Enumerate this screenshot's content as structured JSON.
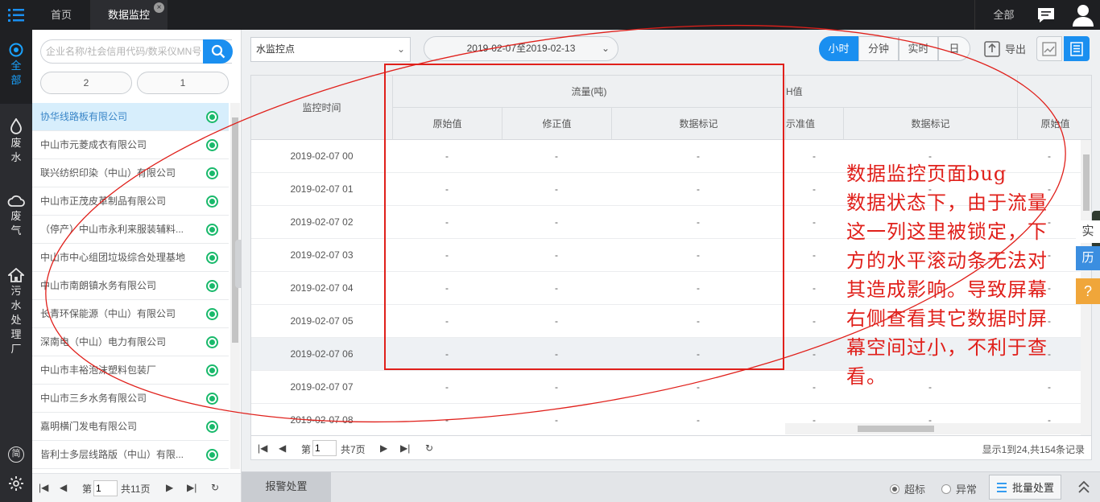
{
  "topbar": {
    "tabs": [
      {
        "label": "首页"
      },
      {
        "label": "数据监控",
        "close": "×"
      }
    ],
    "all_label": "全部"
  },
  "leftnav": {
    "items": [
      {
        "label": "全部"
      },
      {
        "label": "废水"
      },
      {
        "label": "废气"
      },
      {
        "label": "污水处理厂"
      }
    ],
    "simple_label": "简"
  },
  "panel": {
    "search_placeholder": "企业名称/社会信用代码/数采仪MN号",
    "pills": [
      "2",
      "1"
    ],
    "companies": [
      {
        "name": "协华线路板有限公司",
        "selected": true
      },
      {
        "name": "中山市元菱成衣有限公司"
      },
      {
        "name": "联兴纺织印染（中山）有限公司"
      },
      {
        "name": "中山市正茂皮革制品有限公司"
      },
      {
        "name": "（停产）中山市永利来服装辅料..."
      },
      {
        "name": "中山市中心组团垃圾综合处理基地"
      },
      {
        "name": "中山市南朗镇水务有限公司"
      },
      {
        "name": "长青环保能源（中山）有限公司"
      },
      {
        "name": "深南电（中山）电力有限公司"
      },
      {
        "name": "中山市丰裕泡沫塑料包装厂"
      },
      {
        "name": "中山市三乡水务有限公司"
      },
      {
        "name": "嘉明横门发电有限公司"
      },
      {
        "name": "皆利士多层线路版（中山）有限..."
      }
    ],
    "pager": {
      "prefix": "第",
      "page": "1",
      "total": "共11页"
    }
  },
  "toolbar": {
    "point_select": "水监控点",
    "date_range": "2019-02-07至2019-02-13",
    "segments": [
      "小时",
      "分钟",
      "实时",
      "日"
    ],
    "export_label": "导出"
  },
  "table": {
    "headers": {
      "time": "监控时间",
      "flow": "流量(吨)",
      "ph": "H值",
      "raw": "原始值",
      "fixed": "修正值",
      "mark": "数据标记",
      "ph_standard": "示准值",
      "ph_mark": "数据标记",
      "raw2": "原始值"
    },
    "rows": [
      {
        "time": "2019-02-07 00",
        "raw": "-",
        "fixed": "-",
        "mark": "-",
        "ph": "-",
        "phmark": "-",
        "raw2": "-"
      },
      {
        "time": "2019-02-07 01",
        "raw": "-",
        "fixed": "-",
        "mark": "-",
        "ph": "-",
        "phmark": "-",
        "raw2": "-"
      },
      {
        "time": "2019-02-07 02",
        "raw": "-",
        "fixed": "-",
        "mark": "-",
        "ph": "-",
        "phmark": "-",
        "raw2": "-"
      },
      {
        "time": "2019-02-07 03",
        "raw": "-",
        "fixed": "-",
        "mark": "-",
        "ph": "-",
        "phmark": "-",
        "raw2": "-"
      },
      {
        "time": "2019-02-07 04",
        "raw": "-",
        "fixed": "-",
        "mark": "-",
        "ph": "-",
        "phmark": "-",
        "raw2": "-"
      },
      {
        "time": "2019-02-07 05",
        "raw": "-",
        "fixed": "-",
        "mark": "-",
        "ph": "-",
        "phmark": "-",
        "raw2": "-"
      },
      {
        "time": "2019-02-07 06",
        "raw": "-",
        "fixed": "-",
        "mark": "-",
        "ph": "-",
        "phmark": "-",
        "raw2": "-"
      },
      {
        "time": "2019-02-07 07",
        "raw": "-",
        "fixed": "-",
        "mark": "-",
        "ph": "-",
        "phmark": "-",
        "raw2": "-"
      },
      {
        "time": "2019-02-07 08",
        "raw": "-",
        "fixed": "-",
        "mark": "-",
        "ph": "-",
        "phmark": "-",
        "raw2": "-"
      }
    ],
    "pager": {
      "prefix": "第",
      "page": "1",
      "total": "共7页",
      "records": "显示1到24,共154条记录"
    }
  },
  "bottombar": {
    "alarm_label": "报警处置",
    "radio_over": "超标",
    "radio_abnormal": "异常",
    "batch_label": "批量处置"
  },
  "side": {
    "realtime": "实",
    "history": "历",
    "help": "?"
  },
  "annotation": {
    "lines": [
      "数据监控页面bug",
      "数据状态下，由于流量",
      "这一列这里被锁定，下",
      "方的水平滚动条无法对",
      "其造成影响。导致屏幕",
      "右侧查看其它数据时屏",
      "幕空间过小，不利于查",
      "看。"
    ]
  },
  "colors": {
    "accent": "#1a8ff0",
    "status_green": "#19b96b",
    "annotation_red": "#e0201b",
    "topbar": "#1e1f22"
  }
}
